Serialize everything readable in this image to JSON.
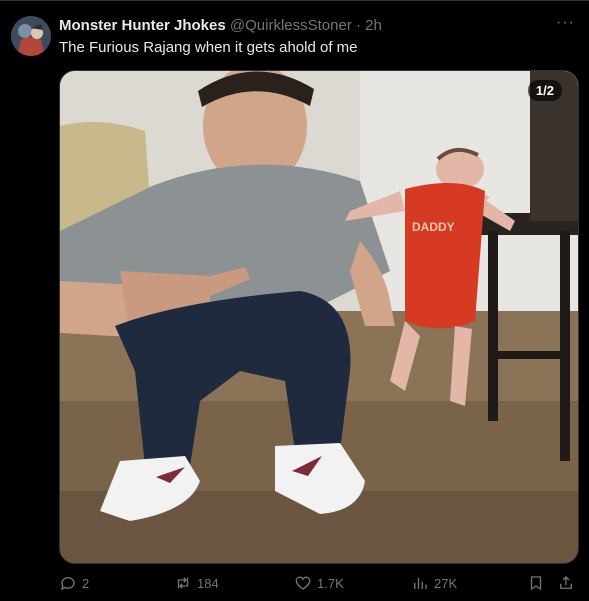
{
  "tweet": {
    "author_name": "Monster Hunter Jhokes",
    "author_handle": "@QuirklessStoner",
    "separator": "·",
    "timestamp": "2h",
    "more_label": "···",
    "text": "The Furious Rajang when it gets ahold of me",
    "media_counter": "1/2",
    "baby_shirt_text": "DADDY",
    "icons": [
      "reply-icon",
      "retweet-icon",
      "like-icon",
      "views-icon",
      "bookmark-icon",
      "share-icon"
    ],
    "stats": {
      "replies": "2",
      "retweets": "184",
      "likes": "1.7K",
      "views": "27K"
    }
  },
  "colors": {
    "background": "#000000",
    "text": "#e7e9ea",
    "muted": "#71767b",
    "border": "#2f3336"
  }
}
